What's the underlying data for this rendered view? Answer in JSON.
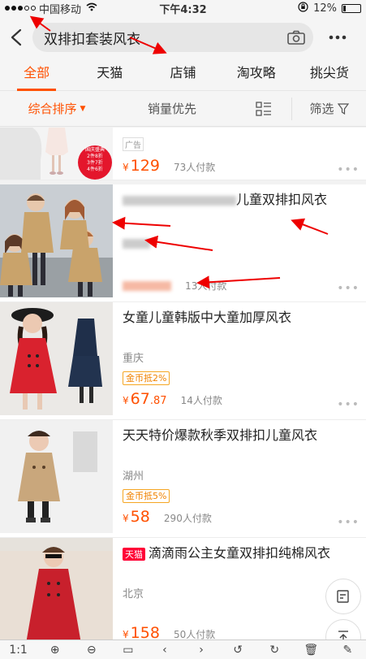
{
  "status": {
    "carrier": "中国移动",
    "time": "下午4:32",
    "battery": "12%"
  },
  "search": {
    "query": "双排扣套装风衣"
  },
  "tabs": [
    "全部",
    "天猫",
    "店铺",
    "淘攻略",
    "挑尖货"
  ],
  "sort": {
    "main": "综合排序",
    "sales": "销量优先",
    "filter": "筛选"
  },
  "products": [
    {
      "ad": "广告",
      "price_int": "129",
      "sold": "73人付款",
      "promo": [
        "国庆盛典",
        "2件8折",
        "3件7折",
        "4件6折"
      ]
    },
    {
      "title_visible": "儿童双排扣风衣",
      "sold": "13人付款"
    },
    {
      "title": "女童儿童韩版中大童加厚风衣",
      "location": "重庆",
      "coin": "金币抵2%",
      "price_int": "67",
      "price_dec": ".87",
      "sold": "14人付款"
    },
    {
      "title": "天天特价爆款秋季双排扣儿童风衣",
      "location": "湖州",
      "coin": "金币抵5%",
      "price_int": "58",
      "sold": "290人付款"
    },
    {
      "tmall": "天猫",
      "title": "滴滴雨公主女童双排扣纯棉风衣",
      "location": "北京",
      "price_int": "158",
      "sold": "50人付款"
    }
  ],
  "toolbar": {
    "zoom": "1:1"
  },
  "yen": "¥"
}
